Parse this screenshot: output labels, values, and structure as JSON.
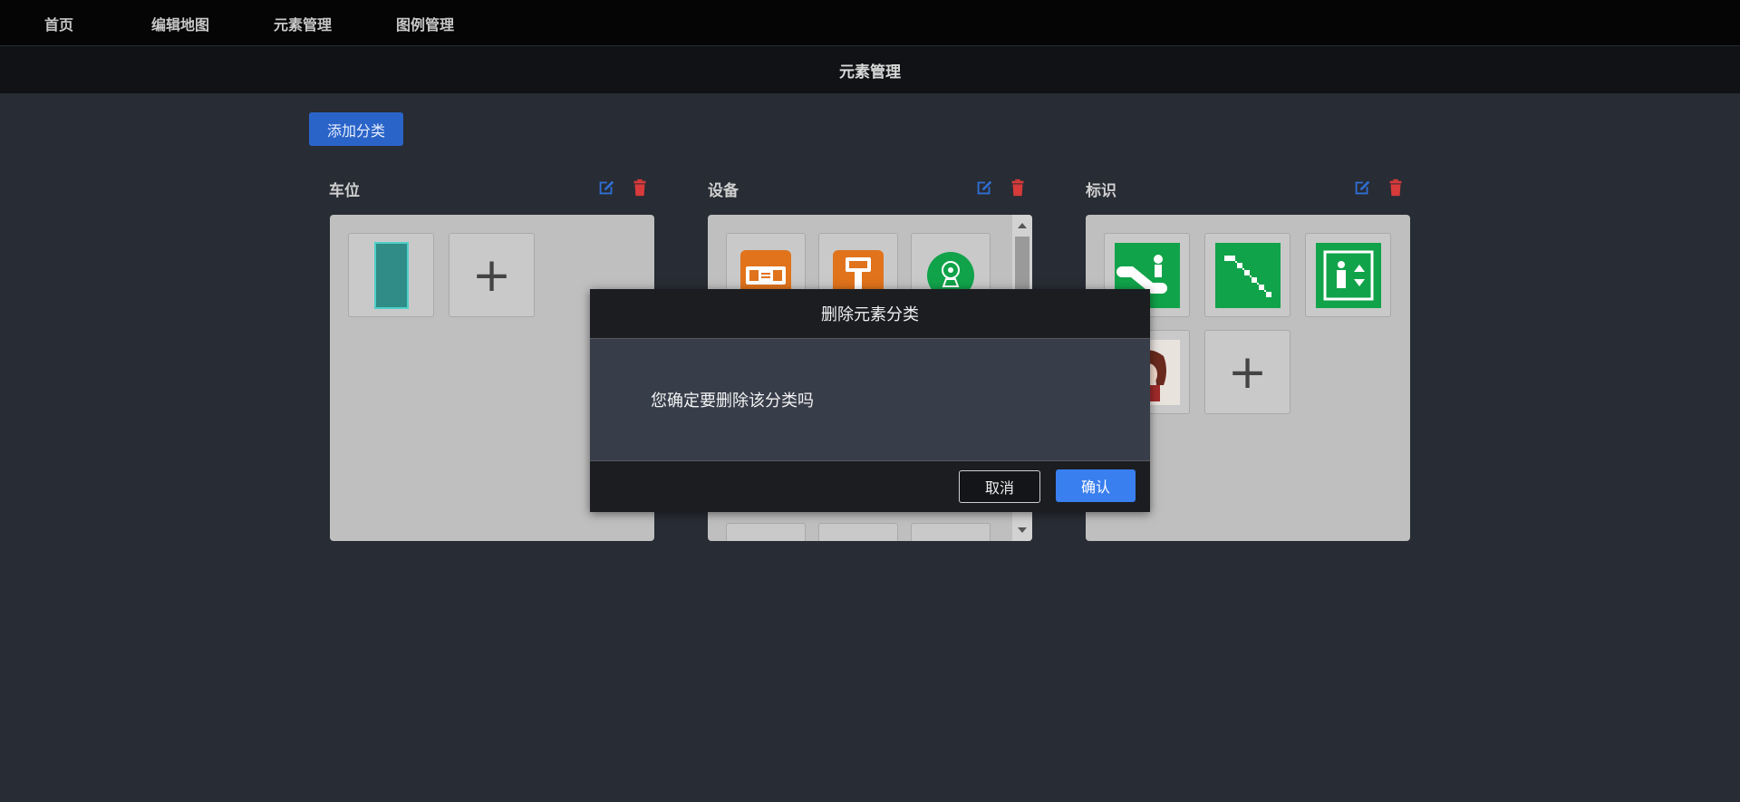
{
  "nav": {
    "items": [
      {
        "label": "首页"
      },
      {
        "label": "编辑地图"
      },
      {
        "label": "元素管理"
      },
      {
        "label": "图例管理"
      }
    ]
  },
  "header": {
    "title": "元素管理"
  },
  "toolbar": {
    "add_category_label": "添加分类"
  },
  "categories": [
    {
      "title": "车位"
    },
    {
      "title": "设备"
    },
    {
      "title": "标识"
    }
  ],
  "modal": {
    "title": "删除元素分类",
    "message": "您确定要删除该分类吗",
    "cancel_label": "取消",
    "confirm_label": "确认"
  },
  "colors": {
    "accent_blue": "#3a7ff0",
    "edit_icon": "#2f6fd6",
    "delete_icon": "#d63a3a",
    "sign_green": "#11a34a",
    "device_orange": "#e0731c",
    "parking_teal": "#2f8c86"
  },
  "icons": {
    "edit": "edit-icon",
    "delete": "trash-icon",
    "add": "plus-icon"
  }
}
